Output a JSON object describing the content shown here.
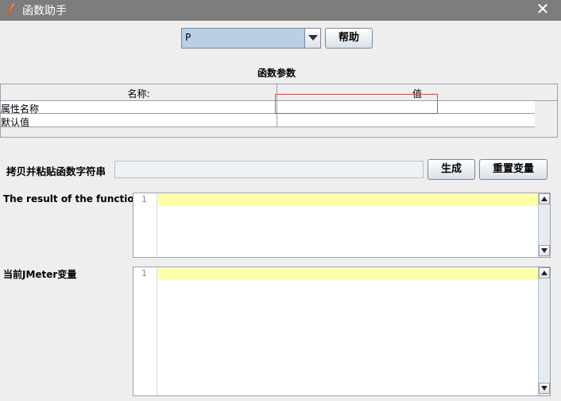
{
  "window": {
    "title": "函数助手",
    "close_symbol": "✕"
  },
  "function_select": {
    "selected": "P"
  },
  "buttons": {
    "help": "帮助",
    "generate": "生成",
    "reset": "重置变量"
  },
  "params": {
    "heading": "函数参数",
    "columns": [
      "名称:",
      "值"
    ],
    "rows": [
      {
        "name": "属性名称",
        "value": ""
      },
      {
        "name": "默认值",
        "value": ""
      }
    ]
  },
  "copy_label": "拷贝并粘贴函数字符串",
  "copy_value": "",
  "result": {
    "label": "The result of the function is",
    "line_number": "1"
  },
  "vars": {
    "label": "当前JMeter变量",
    "line_number": "1"
  },
  "colors": {
    "titlebar": "#7d7d7d",
    "combo_bg": "#b8cfe5",
    "highlight_line": "#ffffa8",
    "annotation_box": "#d84a4a"
  }
}
